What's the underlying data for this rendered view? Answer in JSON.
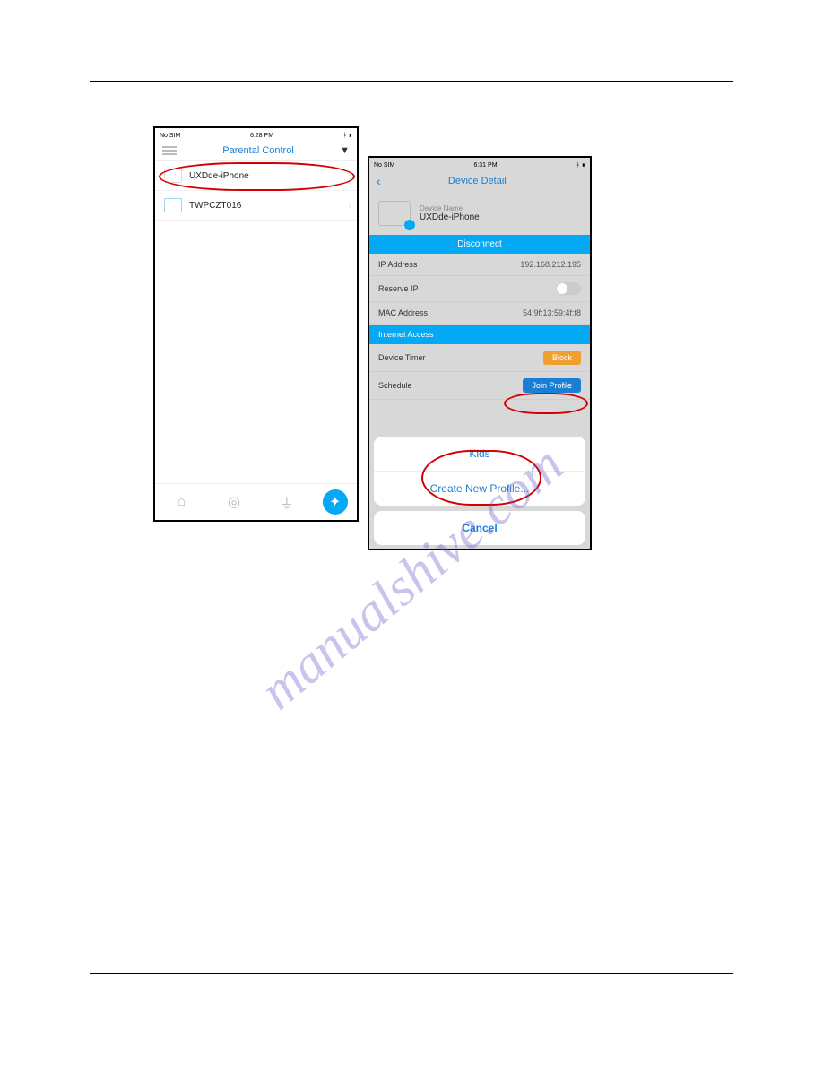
{
  "watermark": "manualshive.com",
  "left_phone": {
    "status": {
      "carrier": "No SIM",
      "time": "6:28 PM"
    },
    "title": "Parental Control",
    "devices": [
      {
        "name": "UXDde-iPhone"
      },
      {
        "name": "TWPCZT016"
      }
    ]
  },
  "right_phone": {
    "status": {
      "carrier": "No SIM",
      "time": "6:31 PM"
    },
    "title": "Device Detail",
    "device_name_label": "Device Name",
    "device_name": "UXDde-iPhone",
    "disconnect": "Disconnect",
    "rows": {
      "ip_label": "IP Address",
      "ip_value": "192.168.212.195",
      "reserve_label": "Reserve IP",
      "mac_label": "MAC Address",
      "mac_value": "54:9f:13:59:4f:f8"
    },
    "section": "Internet Access",
    "timer_label": "Device Timer",
    "timer_button": "Block",
    "schedule_label": "Schedule",
    "schedule_button": "Join Profile",
    "sheet": {
      "opt1": "Kids",
      "opt2": "Create New Profile...",
      "cancel": "Cancel"
    }
  }
}
